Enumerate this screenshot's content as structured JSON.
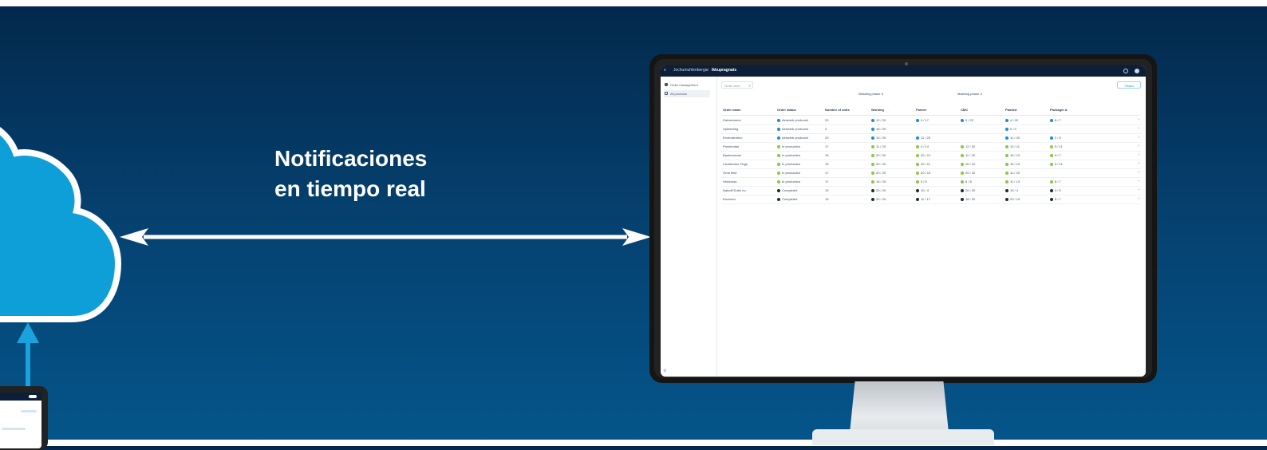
{
  "headline": {
    "line1": "Notificaciones",
    "line2": "en tiempo real"
  },
  "colors": {
    "background_top": "#03284c",
    "background_bottom": "#05558a",
    "cloud_fill": "#0f9fd8",
    "arrow": "#ffffff",
    "upload_arrow": "#1aa2dc",
    "app_topbar": "#0b1f3a",
    "status_blue": "#1a8fc9",
    "status_green": "#8cc63f",
    "status_dark": "#1f2d2a"
  },
  "app": {
    "topbar": {
      "breadcrumb": "Jochumuhlenbergar",
      "title": "Ikkupragnats"
    },
    "sidebar": {
      "items": [
        {
          "label": "Order management"
        },
        {
          "label": "All products"
        }
      ]
    },
    "search": {
      "placeholder": "Order aurn"
    },
    "action_button": "Ytracu",
    "group_headers": [
      "Washing phase ∨",
      "Mashing phase ∨"
    ],
    "columns": [
      "Order name",
      "Order status",
      "Number of units",
      "Working",
      "Fanner",
      "CMC",
      "Painted",
      "Packager A"
    ],
    "rows": [
      {
        "name": "Galvammme",
        "status": "Aeswinb produced",
        "units": "20",
        "dot": "blue"
      },
      {
        "name": "Uplearning",
        "status": "Aeswinb produced",
        "units": "3",
        "dot": "blue"
      },
      {
        "name": "Ervenstention",
        "status": "Aeswinb produced",
        "units": "20",
        "dot": "blue"
      },
      {
        "name": "Prestendas",
        "status": "In production",
        "units": "17",
        "dot": "green"
      },
      {
        "name": "Bauberoman",
        "status": "In production",
        "units": "15",
        "dot": "green"
      },
      {
        "name": "Landemaro Tings",
        "status": "In production",
        "units": "15",
        "dot": "green"
      },
      {
        "name": "Orna field",
        "status": "In production",
        "units": "17",
        "dot": "green"
      },
      {
        "name": "Veldcross",
        "status": "In production",
        "units": "17",
        "dot": "green"
      },
      {
        "name": "Naturill Dube ou",
        "status": "Completed",
        "units": "10",
        "dot": "dark"
      },
      {
        "name": "Rovinam",
        "status": "Completed",
        "units": "10",
        "dot": "dark"
      }
    ],
    "row_values": [
      [
        "12 / 20",
        "4 / 17",
        "9 / 20",
        "4 / 20",
        "8 / 7"
      ],
      [
        "16 / 20",
        "",
        "",
        "0 / 0",
        ""
      ],
      [
        "10 / 20",
        "11 / 20",
        "",
        "11 / 20",
        "2 / 5"
      ],
      [
        "11 / 20",
        "4 / 14",
        "12 / 20",
        "10 / 11",
        "5 / 11"
      ],
      [
        "20 / 20",
        "20 / 21",
        "11 / 20",
        "15 / 10",
        "9 / 7"
      ],
      [
        "20 / 20",
        "20 / 11",
        "20 / 10",
        "15 / 10",
        "9 / 11"
      ],
      [
        "20 / 20",
        "20 / 10",
        "20 / 20",
        "11 / 20",
        ""
      ],
      [
        "15 / 20",
        "5 / 5",
        "8 / 8",
        "11 / 13",
        "8 / 7"
      ],
      [
        "20 / 20",
        "10 / 4",
        "20 / 20",
        "10 / 4",
        "4 / 5"
      ],
      [
        "20 / 20",
        "11 / 17",
        "18 / 20",
        "20 / 19",
        "8 / 7"
      ]
    ]
  }
}
